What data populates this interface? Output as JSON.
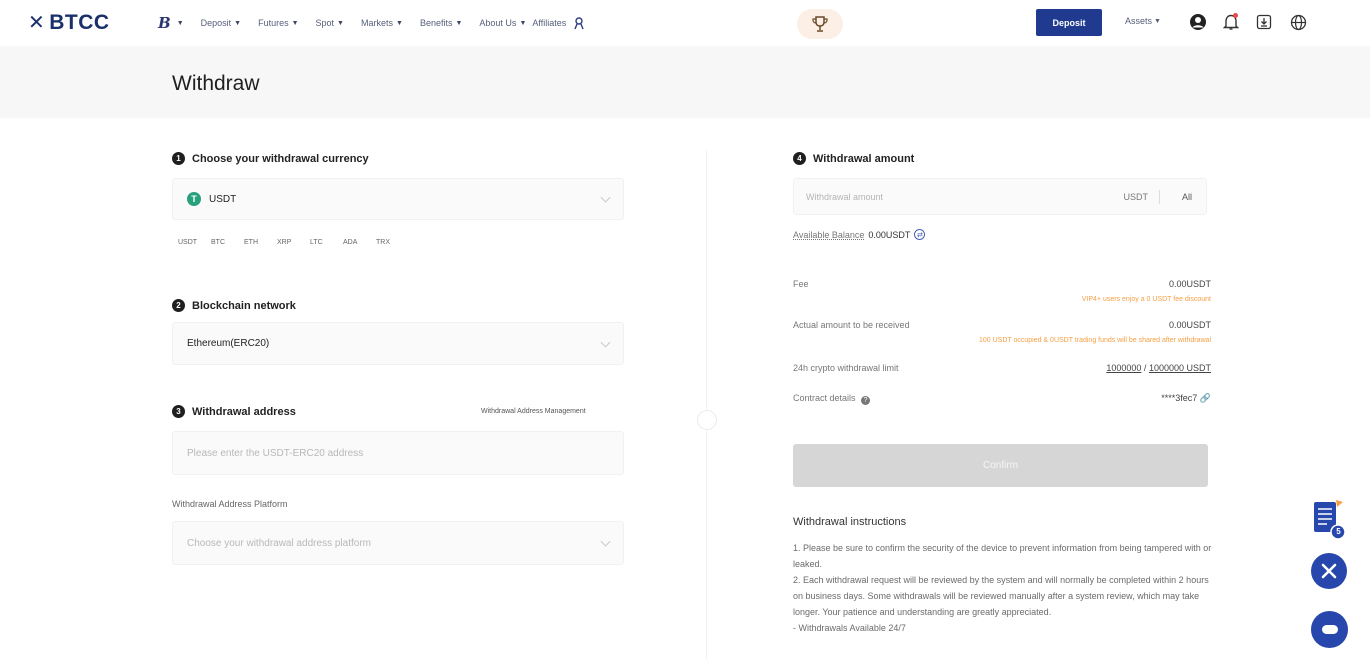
{
  "brand": {
    "name": "BTCC",
    "mark": "✕"
  },
  "nav": {
    "b_logo": "B",
    "items": [
      {
        "label": "Deposit",
        "caret": true
      },
      {
        "label": "Futures",
        "caret": true
      },
      {
        "label": "Spot",
        "caret": true
      },
      {
        "label": "Markets",
        "caret": true
      },
      {
        "label": "Benefits",
        "caret": true
      },
      {
        "label": "About Us",
        "caret": true
      }
    ],
    "affiliates": "Affiliates"
  },
  "topbar": {
    "deposit_label": "Deposit",
    "assets_label": "Assets"
  },
  "page": {
    "title": "Withdraw"
  },
  "step1": {
    "num": "1",
    "title": "Choose your withdrawal currency",
    "selected_icon": "T",
    "selected": "USDT",
    "chips": [
      "USDT",
      "BTC",
      "ETH",
      "XRP",
      "LTC",
      "ADA",
      "TRX"
    ]
  },
  "step2": {
    "num": "2",
    "title": "Blockchain network",
    "selected": "Ethereum(ERC20)"
  },
  "step3": {
    "num": "3",
    "title": "Withdrawal address",
    "manage_link": "Withdrawal Address Management",
    "address_placeholder": "Please enter the USDT-ERC20 address",
    "platform_label": "Withdrawal Address Platform",
    "platform_placeholder": "Choose your withdrawal address platform"
  },
  "step4": {
    "num": "4",
    "title": "Withdrawal amount",
    "amount_placeholder": "Withdrawal amount",
    "unit": "USDT",
    "all_label": "All",
    "balance_label": "Available Balance",
    "balance_value": "0.00USDT",
    "fee_label": "Fee",
    "fee_value": "0.00USDT",
    "fee_warning": "VIP4+ users enjoy a 0 USDT fee discount",
    "actual_label": "Actual amount to be received",
    "actual_value": "0.00USDT",
    "actual_warning": "100 USDT occupied & 0USDT trading funds will be shared after withdrawal",
    "limit_label": "24h crypto withdrawal limit",
    "limit_used": "1000000",
    "limit_sep": "/",
    "limit_total": "1000000 USDT",
    "contract_label": "Contract details",
    "contract_value": "****3fec7",
    "confirm_label": "Confirm"
  },
  "instructions": {
    "title": "Withdrawal instructions",
    "lines": [
      "1. Please be sure to confirm the security of the device to prevent information from being tampered with or leaked.",
      "2. Each withdrawal request will be reviewed by the system and will normally be completed within 2 hours on business days. Some withdrawals will be reviewed manually after a system review, which may take longer. Your patience and understanding are greatly appreciated.",
      "- Withdrawals Available 24/7"
    ]
  },
  "floating": {
    "badge_count": "5"
  }
}
